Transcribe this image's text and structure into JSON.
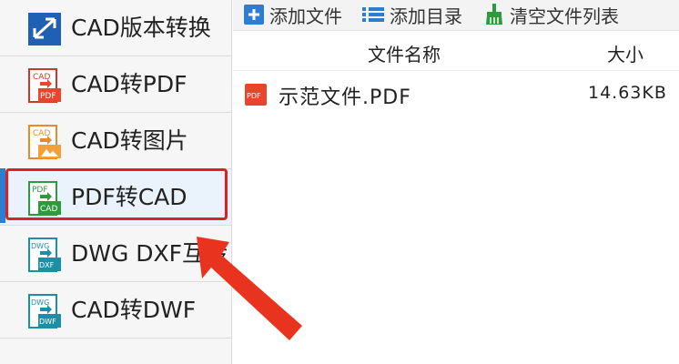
{
  "sidebar": {
    "items": [
      {
        "label": "CAD版本转换",
        "icon": "cad-version-icon"
      },
      {
        "label": "CAD转PDF",
        "icon": "cad-to-pdf-icon",
        "icon_top": "CAD",
        "icon_bottom": "PDF"
      },
      {
        "label": "CAD转图片",
        "icon": "cad-to-image-icon",
        "icon_top": "CAD"
      },
      {
        "label": "PDF转CAD",
        "icon": "pdf-to-cad-icon",
        "icon_top": "PDF",
        "icon_bottom": "CAD",
        "active": true
      },
      {
        "label": "DWG DXF互转",
        "icon": "dwg-dxf-icon",
        "icon_top": "DWG",
        "icon_bottom": "DXF"
      },
      {
        "label": "CAD转DWF",
        "icon": "cad-to-dwf-icon",
        "icon_top": "DWG",
        "icon_bottom": "DWF"
      }
    ]
  },
  "toolbar": {
    "add_file_label": "添加文件",
    "add_folder_label": "添加目录",
    "clear_list_label": "清空文件列表"
  },
  "table": {
    "headers": {
      "name": "文件名称",
      "size": "大小"
    },
    "rows": [
      {
        "name": "示范文件.PDF",
        "size": "14.63KB",
        "icon_text": "PDF"
      }
    ]
  },
  "colors": {
    "accent": "#2d7dd2",
    "highlight": "#e02020",
    "pdf_red": "#e8452c",
    "cad_green": "#2e9a3e",
    "cad_orange": "#e98a2a",
    "teal": "#1b8fa5"
  }
}
